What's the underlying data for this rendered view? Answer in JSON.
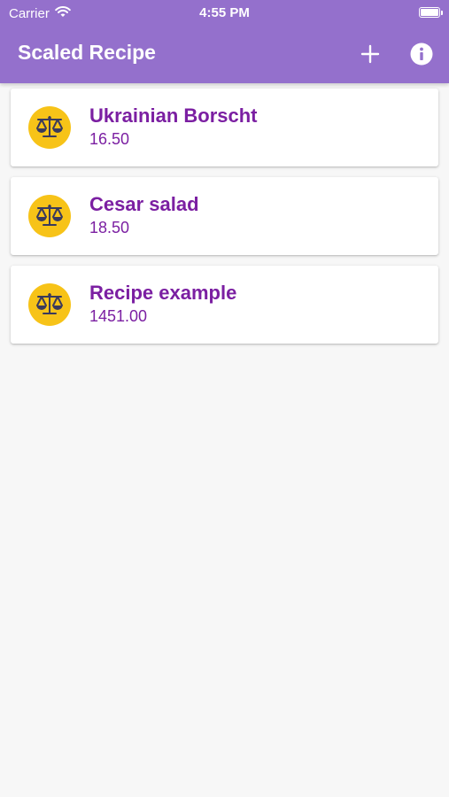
{
  "status_bar": {
    "carrier": "Carrier",
    "time": "4:55 PM",
    "icons": [
      "wifi-icon",
      "battery-icon"
    ]
  },
  "app_bar": {
    "title": "Scaled Recipe",
    "actions": [
      {
        "name": "add",
        "icon": "plus-icon"
      },
      {
        "name": "info",
        "icon": "info-icon"
      }
    ]
  },
  "recipes": [
    {
      "title": "Ukrainian Borscht",
      "value": "16.50",
      "icon": "balance-scale-icon"
    },
    {
      "title": "Cesar salad",
      "value": "18.50",
      "icon": "balance-scale-icon"
    },
    {
      "title": "Recipe example",
      "value": "1451.00",
      "icon": "balance-scale-icon"
    }
  ],
  "colors": {
    "app_bar": "#9470cc",
    "accent_text": "#7b1fa2",
    "avatar": "#f7c318",
    "background": "#f7f7f7",
    "icon": "#3a3a5c"
  }
}
